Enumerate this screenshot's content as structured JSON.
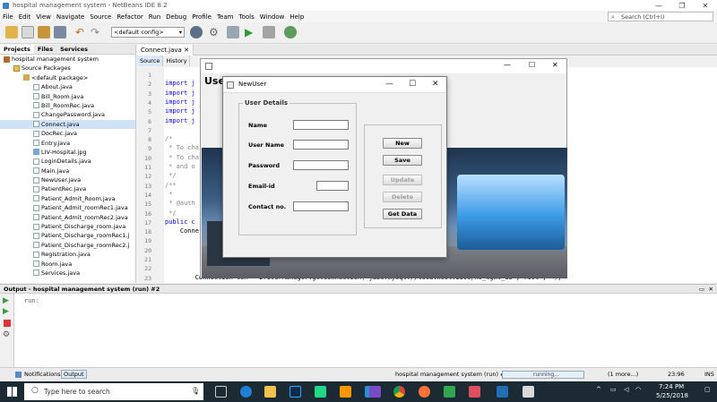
{
  "window": {
    "title": "hospital management system - NetBeans IDE 8.2"
  },
  "menu": [
    "File",
    "Edit",
    "View",
    "Navigate",
    "Source",
    "Refactor",
    "Run",
    "Debug",
    "Profile",
    "Team",
    "Tools",
    "Window",
    "Help"
  ],
  "search": {
    "placeholder": "Search (Ctrl+I)"
  },
  "toolbar": {
    "config": "<default config>"
  },
  "projects": {
    "tabs": [
      "Projects",
      "Files",
      "Services"
    ],
    "tree": [
      {
        "label": "hospital management system",
        "type": "proj",
        "indent": 0
      },
      {
        "label": "Source Packages",
        "type": "folder",
        "indent": 1
      },
      {
        "label": "<default package>",
        "type": "pkg",
        "indent": 2
      },
      {
        "label": "About.java",
        "type": "java",
        "indent": 3
      },
      {
        "label": "Bill_Room.java",
        "type": "java",
        "indent": 3
      },
      {
        "label": "Bill_RoomRec.java",
        "type": "java",
        "indent": 3
      },
      {
        "label": "ChangePassword.java",
        "type": "java",
        "indent": 3
      },
      {
        "label": "Connect.java",
        "type": "java",
        "indent": 3,
        "selected": true
      },
      {
        "label": "DocRec.java",
        "type": "java",
        "indent": 3
      },
      {
        "label": "Entry.java",
        "type": "java",
        "indent": 3
      },
      {
        "label": "LIV-Hospital.jpg",
        "type": "img",
        "indent": 3
      },
      {
        "label": "LoginDetails.java",
        "type": "java",
        "indent": 3
      },
      {
        "label": "Main.java",
        "type": "java",
        "indent": 3
      },
      {
        "label": "NewUser.java",
        "type": "java",
        "indent": 3
      },
      {
        "label": "PatientRec.java",
        "type": "java",
        "indent": 3
      },
      {
        "label": "Patient_Admit_Room.java",
        "type": "java",
        "indent": 3
      },
      {
        "label": "Patient_Admit_roomRec1.java",
        "type": "java",
        "indent": 3
      },
      {
        "label": "Patient_Admit_roomRec2.java",
        "type": "java",
        "indent": 3
      },
      {
        "label": "Patient_Discharge_room.java",
        "type": "java",
        "indent": 3
      },
      {
        "label": "Patient_Discharge_roomRec1.j",
        "type": "java",
        "indent": 3
      },
      {
        "label": "Patient_Discharge_roomRec2.j",
        "type": "java",
        "indent": 3
      },
      {
        "label": "Registration.java",
        "type": "java",
        "indent": 3
      },
      {
        "label": "Room.java",
        "type": "java",
        "indent": 3
      },
      {
        "label": "Services.java",
        "type": "java",
        "indent": 3
      }
    ]
  },
  "editor": {
    "tab": "Connect.java",
    "subtabs": [
      "Source",
      "History"
    ],
    "lines": [
      {
        "n": "1",
        "t": ""
      },
      {
        "n": "2",
        "t": "import j"
      },
      {
        "n": "3",
        "t": "import j"
      },
      {
        "n": "4",
        "t": "import j"
      },
      {
        "n": "5",
        "t": "import j"
      },
      {
        "n": "6",
        "t": "import j"
      },
      {
        "n": "7",
        "t": ""
      },
      {
        "n": "8",
        "t": "/*"
      },
      {
        "n": "9",
        "t": " * To cha"
      },
      {
        "n": "10",
        "t": " * To cha"
      },
      {
        "n": "11",
        "t": " * and o"
      },
      {
        "n": "12",
        "t": " */"
      },
      {
        "n": "13",
        "t": "/**"
      },
      {
        "n": "14",
        "t": " *"
      },
      {
        "n": "15",
        "t": " * @auth"
      },
      {
        "n": "16",
        "t": " */"
      },
      {
        "n": "17",
        "t": "public c"
      },
      {
        "n": "18",
        "t": "    Conne"
      },
      {
        "n": "19",
        "t": ""
      },
      {
        "n": "20",
        "t": ""
      },
      {
        "n": "21",
        "t": "        "
      },
      {
        "n": "22",
        "t": ""
      },
      {
        "n": "23",
        "t": "        Connection con = DriverManager.getConnection(\"jdbc:mysql://localhost:3306/hs_mgmt_db\",\"root\",\"\");"
      }
    ]
  },
  "bgframe": {
    "title": "User"
  },
  "dialog": {
    "title": "NewUser",
    "legend": "User Details",
    "fields": [
      {
        "label": "Name",
        "value": ""
      },
      {
        "label": "User Name",
        "value": ""
      },
      {
        "label": "Password",
        "value": ""
      },
      {
        "label": "Email-id",
        "value": ""
      },
      {
        "label": "Contact no.",
        "value": ""
      }
    ],
    "buttons": [
      {
        "label": "New",
        "enabled": true
      },
      {
        "label": "Save",
        "enabled": true
      },
      {
        "label": "Update",
        "enabled": false
      },
      {
        "label": "Delete",
        "enabled": false
      },
      {
        "label": "Get Data",
        "enabled": true
      }
    ]
  },
  "output": {
    "title": "Output - hospital management system (run) #2",
    "text": "run:"
  },
  "statusbar": {
    "tabs": [
      "Notifications",
      "Output"
    ],
    "task": "hospital management system (run) #2",
    "progress": "running...",
    "more": "(1 more...)",
    "position": "23:96",
    "mode": "INS"
  },
  "taskbar": {
    "search_placeholder": "Type here to search",
    "time": "7:24 PM",
    "date": "5/25/2018"
  }
}
